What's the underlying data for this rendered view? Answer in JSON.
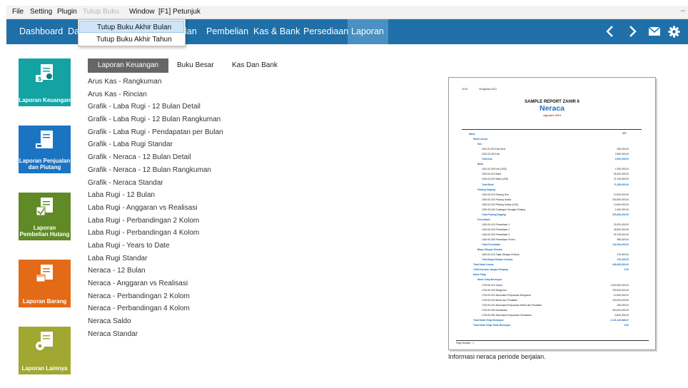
{
  "menubar": {
    "file": "File",
    "setting": "Setting",
    "plugin": "Plugin",
    "tutup_buku": "Tutup Buku",
    "window": "Window",
    "petunjuk": "[F1] Petunjuk",
    "dash": "–"
  },
  "nav": {
    "dashboard": "Dashboard",
    "data_partial": "Da",
    "penjualan_partial": "lan",
    "pembelian": "Pembelian",
    "kas_bank": "Kas & Bank",
    "persediaan": "Persediaan",
    "laporan": "Laporan",
    "icons": [
      "chevron-left-icon",
      "chevron-right-icon",
      "mail-icon",
      "gear-icon"
    ]
  },
  "dropdown": {
    "items": [
      "Tutup Buku Akhir Bulan",
      "Tutup Buku Akhir Tahun"
    ]
  },
  "tiles": [
    {
      "label": "Laporan Keuangan",
      "color": "#13a3a3"
    },
    {
      "label": "Laporan Penjualan dan Piutang",
      "color": "#1b74c2"
    },
    {
      "label": "Laporan Pembelian Hutang",
      "color": "#5f8a25"
    },
    {
      "label": "Laporan Barang",
      "color": "#e36a17"
    },
    {
      "label": "Laporan Lainnya",
      "color": "#a0a832"
    }
  ],
  "tabs": [
    "Laporan Keuangan",
    "Buku Besar",
    "Kas Dan Bank"
  ],
  "reports": [
    "Arus Kas - Rangkuman",
    "Arus Kas - Rincian",
    "Grafik - Laba Rugi - 12 Bulan Detail",
    "Grafik - Laba Rugi - 12 Bulan Rangkuman",
    "Grafik - Laba Rugi - Pendapatan per Bulan",
    "Grafik - Laba Rugi Standar",
    "Grafik - Neraca - 12 Bulan Detail",
    "Grafik - Neraca - 12 Bulan Rangkuman",
    "Grafik - Neraca Standar",
    "Laba Rugi - 12 Bulan",
    "Laba Rugi - Anggaran vs Realisasi",
    "Laba Rugi - Perbandingan 2 Kolom",
    "Laba Rugi - Perbandingan 4 Kolom",
    "Laba Rugi - Years to Date",
    "Laba Rugi Standar",
    "Neraca - 12 Bulan",
    "Neraca - Anggaran vs Realisasi",
    "Neraca - Perbandingan 2 Kolom",
    "Neraca - Perbandingan 4 Kolom",
    "Neraca Saldo",
    "Neraca Standar"
  ],
  "preview": {
    "time": "15:31",
    "date": "30 Agustus 2013",
    "company": "SAMPLE REPORT ZAHIR 6",
    "title": "Neraca",
    "period": "Agustus 2013",
    "col_header": "IDR",
    "page_number": "Page Number : 1",
    "lines": [
      {
        "text": "Harta",
        "blue": true,
        "val": ""
      },
      {
        "text": "Harta Lancar",
        "blue": true,
        "val": ""
      },
      {
        "text": "Kas",
        "blue": true,
        "val": ""
      },
      {
        "text": "1100-00-010  Kas Kecil",
        "val": "250,000.00"
      },
      {
        "text": "1100-00-020  Kas",
        "val": "2,550,000.00"
      },
      {
        "text": "Total Kas",
        "blue": true,
        "val": "2,600,000.00"
      },
      {
        "text": "Bank",
        "blue": true,
        "val": ""
      },
      {
        "text": "1100-00-030  Kas (USD)",
        "val": "1,050,000.00"
      },
      {
        "text": "1200-00-010  Bank",
        "val": "55,200,000.00"
      },
      {
        "text": "1200-00-020  Bank (USD)",
        "val": "21,105,600.00"
      },
      {
        "text": "Total Bank",
        "blue": true,
        "val": "71,355,600.00"
      },
      {
        "text": "Piutang Dagang",
        "blue": true,
        "val": ""
      },
      {
        "text": "1300-00-010  Piutang Giro",
        "val": "10,000,000.00"
      },
      {
        "text": "1300-00-020  Piutang Usaha",
        "val": "202,893,000.00"
      },
      {
        "text": "1300-00-030  Piutang Usaha (USD)",
        "val": "13,600,000.00"
      },
      {
        "text": "1300-00-040  Cadangan Kerugian Piutang",
        "val": "-1,000,000.00"
      },
      {
        "text": "Total Piutang Dagang",
        "blue": true,
        "val": "225,493,000.00"
      },
      {
        "text": "Persediaan",
        "blue": true,
        "val": ""
      },
      {
        "text": "1400-00-010  Persediaan 1",
        "val": "20,291,000.00"
      },
      {
        "text": "1400-00-020  Persediaan 2",
        "val": "28,940,000.00"
      },
      {
        "text": "1400-00-030  Persediaan 3",
        "val": "92,705,000.00"
      },
      {
        "text": "1400-00-050  Persediaan Promo",
        "val": "980,000.00"
      },
      {
        "text": "Total Persediaan",
        "blue": true,
        "val": "142,916,000.00"
      },
      {
        "text": "Biaya Dibayar Dimuka",
        "blue": true,
        "val": ""
      },
      {
        "text": "1500-00-010  Pajak Dibayar di Muka",
        "val": "370,000.00"
      },
      {
        "text": "Total Biaya Dibayar Dimuka",
        "blue": true,
        "val": "370,000.00"
      },
      {
        "text": "Total Harta Lancar",
        "blue": true,
        "val": "448,282,600.00"
      },
      {
        "text": "Total Investasi Jangka Panjang",
        "blue": true,
        "val": "0.00"
      },
      {
        "text": "Harta Tetap",
        "blue": true,
        "val": ""
      },
      {
        "text": "Harta Tetap Berwujud",
        "blue": true,
        "val": ""
      },
      {
        "text": "1700-00-010  Tanah",
        "val": "1,000,000,000.00"
      },
      {
        "text": "1700-00-020  Bangunan",
        "val": "750,000,000.00"
      },
      {
        "text": "1700-00-021  Akumulasi Penyusutan Bangunan",
        "val": "-12,500,000.00"
      },
      {
        "text": "1700-00-030  Mesin dan Peralatan",
        "val": "100,000,000.00"
      },
      {
        "text": "1700-00-031  Akumulasi Penyusutan Mesin dan Peralatan",
        "val": "-250,000.00"
      },
      {
        "text": "1700-00-050  Kendaraan",
        "val": "300,000,000.00"
      },
      {
        "text": "1700-00-051  Akumulasi Penyusutan Kendaraan",
        "val": "-5,833,333.33"
      },
      {
        "text": "Total Harta Tetap Berwujud",
        "blue": true,
        "val": "2,131,416,666.67"
      },
      {
        "text": "Total Harta Tetap Tidak Berwujud",
        "blue": true,
        "val": "0.00"
      }
    ]
  },
  "preview_info": "Informasi neraca periode berjalan."
}
